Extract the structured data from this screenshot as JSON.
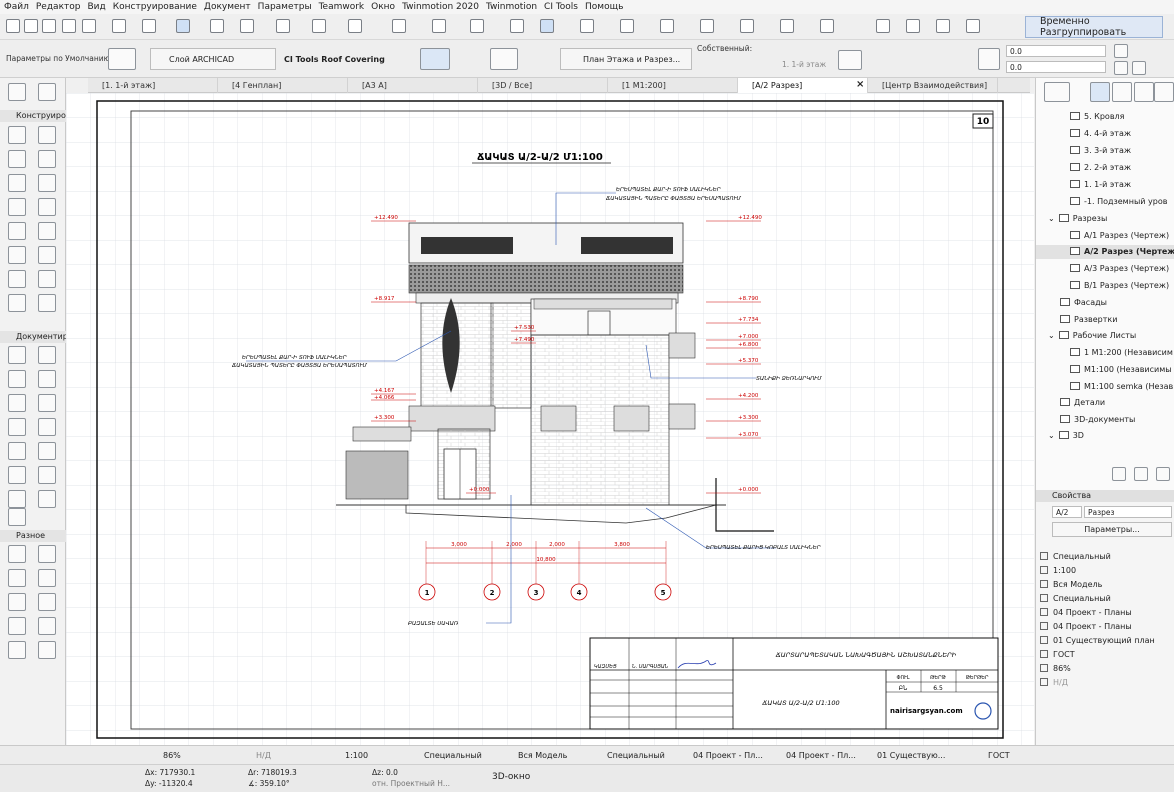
{
  "menu": [
    "Файл",
    "Редактор",
    "Вид",
    "Конструирование",
    "Документ",
    "Параметры",
    "Teamwork",
    "Окно",
    "Twinmotion 2020",
    "Twinmotion",
    "CI Tools",
    "Помощь"
  ],
  "toolbar": {
    "temp_button": "Временно Разгруппировать"
  },
  "infobox": {
    "default_params": "Параметры по Умолчанию",
    "layer": "Слой ARCHICAD",
    "ci_tools": "CI Tools Roof Covering",
    "view": "План Этажа и Разрез...",
    "own_label": "Собственный:",
    "floor": "1. 1-й этаж",
    "value1": "0.0",
    "value2": "0.0"
  },
  "tabs": [
    "[1. 1-й этаж]",
    "[4 Генплан]",
    "[А3 А]",
    "[3D / Все]",
    "[1 М1:200]",
    "[А/2 Разрез]",
    "[Центр Взаимодействия]"
  ],
  "toolbox": {
    "sections": [
      "Конструирова",
      "Документиро",
      "Разное"
    ]
  },
  "navigator": {
    "items": [
      "5. Кровля",
      "4. 4-й этаж",
      "3. 3-й этаж",
      "2. 2-й этаж",
      "1. 1-й этаж",
      "-1. Подземный уров",
      "Разрезы",
      "А/1 Разрез (Чертеж)",
      "А/2 Разрез (Чертеж)",
      "А/3 Разрез (Чертеж)",
      "В/1 Разрез (Чертеж)",
      "Фасады",
      "Развертки",
      "Рабочие Листы",
      "1 М1:200 (Независим",
      "М1:100 (Независимы",
      "М1:100 semka (Незав",
      "Детали",
      "3D-документы",
      "3D"
    ]
  },
  "properties": {
    "title": "Свойства",
    "id": "А/2",
    "name": "Разрез",
    "params_button": "Параметры...",
    "rows": [
      "Специальный",
      "1:100",
      "Вся Модель",
      "Специальный",
      "04 Проект - Планы",
      "04 Проект - Планы",
      "01 Существующий план",
      "ГОСТ",
      "86%",
      "Н/Д"
    ]
  },
  "drawing": {
    "sheet_number": "10",
    "title": "ՃԱԿԱՏ Ա/2-Ա/2  Մ1:100",
    "levels_left": [
      "+12.490",
      "+8.917",
      "+7.530",
      "+7.490",
      "+4.167",
      "+4.066",
      "+3.300",
      "+0.000"
    ],
    "levels_right": [
      "+12.490",
      "+8.790",
      "+7.734",
      "+7.000",
      "+6.800",
      "+5.370",
      "+4.200",
      "+3.300",
      "+3.070",
      "+0.000"
    ],
    "dims": [
      "3,000",
      "2,000",
      "2,000",
      "3,800"
    ],
    "total_dim": "10,800",
    "axes": [
      "1",
      "2",
      "3",
      "4",
      "5"
    ],
    "notes": [
      "ԵՐԵՍՊԱՏԵԼ ՔԱՐ-Ի ՏՈՒՖ ՍԱԼԻԿՆԵՐ",
      "ՃԱԿԱՏԱՅԻՆ ՊԱՏԵՐԸ ՓԱՅՏՅԱ ԵՐԵՍԱՊԱՏՈՒՄ",
      "ՏԱՆԻՔԻ ՁԵՌՆԱՐԿՈՒՄ",
      "ԵՐԵՍՊԱՏԵԼ ՔԱՐԻՑ ԿՈԲԱԼՏ ՍԱԼԻԿՆԵՐ",
      "ԲԱԶԱԼՏԵ ՍԱՎԱՌ"
    ],
    "stamp": {
      "org": "ՃԱՐՏԱՐԱՊԵՏԱԿԱՆ ՆԱԽԱԳԾԱՅԻՆ ԱՇԽԱՏԱՆՔՆԵՐԻ",
      "designer": "Ն. ՍԱՐԳՍՅԱՆ",
      "role": "ԿԱԶՄԵՑ",
      "sheet_title": "ՃԱԿԱՏ Ա/2-Ա/2  Մ1:100",
      "stage_h": "ՓՈՒԼ",
      "sheet_h": "ԹԵՐԹ",
      "sheets_h": "ԹԵՐԹԵՐ",
      "stage": "ԲՆ",
      "sheet": "6.5",
      "website": "nairisargsyan.com"
    }
  },
  "status": {
    "zoom": "86%",
    "nd": "Н/Д",
    "scale": "1:100",
    "s1": "Специальный",
    "s2": "Вся Модель",
    "s3": "Специальный",
    "s4": "04 Проект - Пл...",
    "s5": "04 Проект - Пл...",
    "s6": "01 Существую...",
    "s7": "ГОСТ"
  },
  "coords": {
    "ax": "Δx: 717930.1",
    "ay": "Δy: -11320.4",
    "dx": "Δr: 718019.3",
    "angle": "∡: 359.10°",
    "az": "Δz: 0.0",
    "ref": "отн. Проектный Н...",
    "view3d": "3D-окно"
  }
}
